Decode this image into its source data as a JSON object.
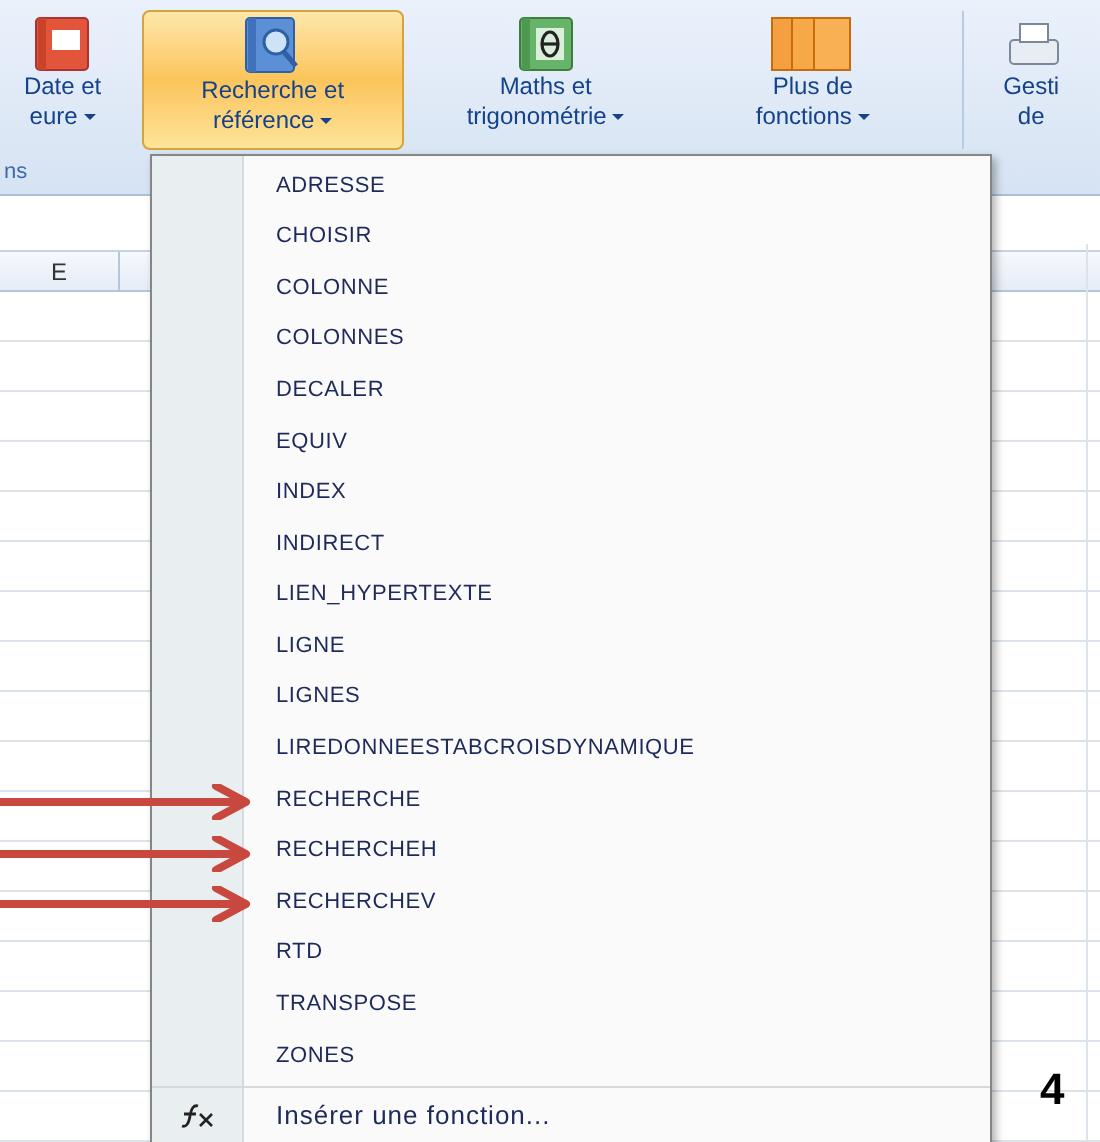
{
  "ribbon": {
    "buttons": [
      {
        "kind": "calendar",
        "lines": [
          "Date et",
          "eure"
        ],
        "caret": true,
        "selected": false
      },
      {
        "kind": "magnifier",
        "lines": [
          "Recherche et",
          "référence"
        ],
        "caret": true,
        "selected": true
      },
      {
        "kind": "theta",
        "lines": [
          "Maths et",
          "trigonométrie"
        ],
        "caret": true,
        "selected": false
      },
      {
        "kind": "books",
        "lines": [
          "Plus de",
          "fonctions"
        ],
        "caret": true,
        "selected": false
      },
      {
        "kind": "tray",
        "lines": [
          "Gesti",
          "de"
        ],
        "caret": false,
        "selected": false
      }
    ],
    "group_label": "ns"
  },
  "sheet": {
    "column_header": "E"
  },
  "menu": {
    "items": [
      {
        "label": "ADRESSE",
        "annotated": false
      },
      {
        "label": "CHOISIR",
        "annotated": false
      },
      {
        "label": "COLONNE",
        "annotated": false
      },
      {
        "label": "COLONNES",
        "annotated": false
      },
      {
        "label": "DECALER",
        "annotated": false
      },
      {
        "label": "EQUIV",
        "annotated": false
      },
      {
        "label": "INDEX",
        "annotated": false
      },
      {
        "label": "INDIRECT",
        "annotated": false
      },
      {
        "label": "LIEN_HYPERTEXTE",
        "annotated": false
      },
      {
        "label": "LIGNE",
        "annotated": false
      },
      {
        "label": "LIGNES",
        "annotated": false
      },
      {
        "label": "LIREDONNEESTABCROISDYNAMIQUE",
        "annotated": false
      },
      {
        "label": "RECHERCHE",
        "annotated": true
      },
      {
        "label": "RECHERCHEH",
        "annotated": true
      },
      {
        "label": "RECHERCHEV",
        "annotated": true
      },
      {
        "label": "RTD",
        "annotated": false
      },
      {
        "label": "TRANSPOSE",
        "annotated": false
      },
      {
        "label": "ZONES",
        "annotated": false
      }
    ],
    "footer": "Insérer une fonction..."
  },
  "page_number": "4"
}
